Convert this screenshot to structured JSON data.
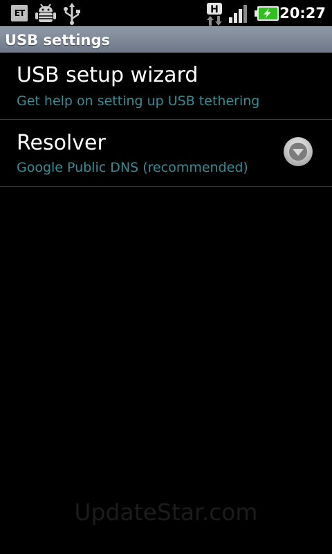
{
  "status_bar": {
    "left_icons": [
      "et-notification-icon",
      "android-debug-icon",
      "usb-icon"
    ],
    "right_icons": [
      "hspa-data-icon",
      "signal-strength-icon",
      "battery-charging-icon"
    ],
    "network_type": "H",
    "time": "20:27",
    "battery_color": "#2fbf1f"
  },
  "title_bar": {
    "title": "USB settings"
  },
  "settings": [
    {
      "title": "USB setup wizard",
      "summary": "Get help on setting up USB tethering"
    },
    {
      "title": "Resolver",
      "summary": "Google Public DNS (recommended)",
      "control": "dropdown-arrow-icon"
    }
  ],
  "colors": {
    "summary_text": "#2f8f97",
    "title_bar": "#7d8696",
    "background": "#000000"
  },
  "watermark": "UpdateStar.com"
}
